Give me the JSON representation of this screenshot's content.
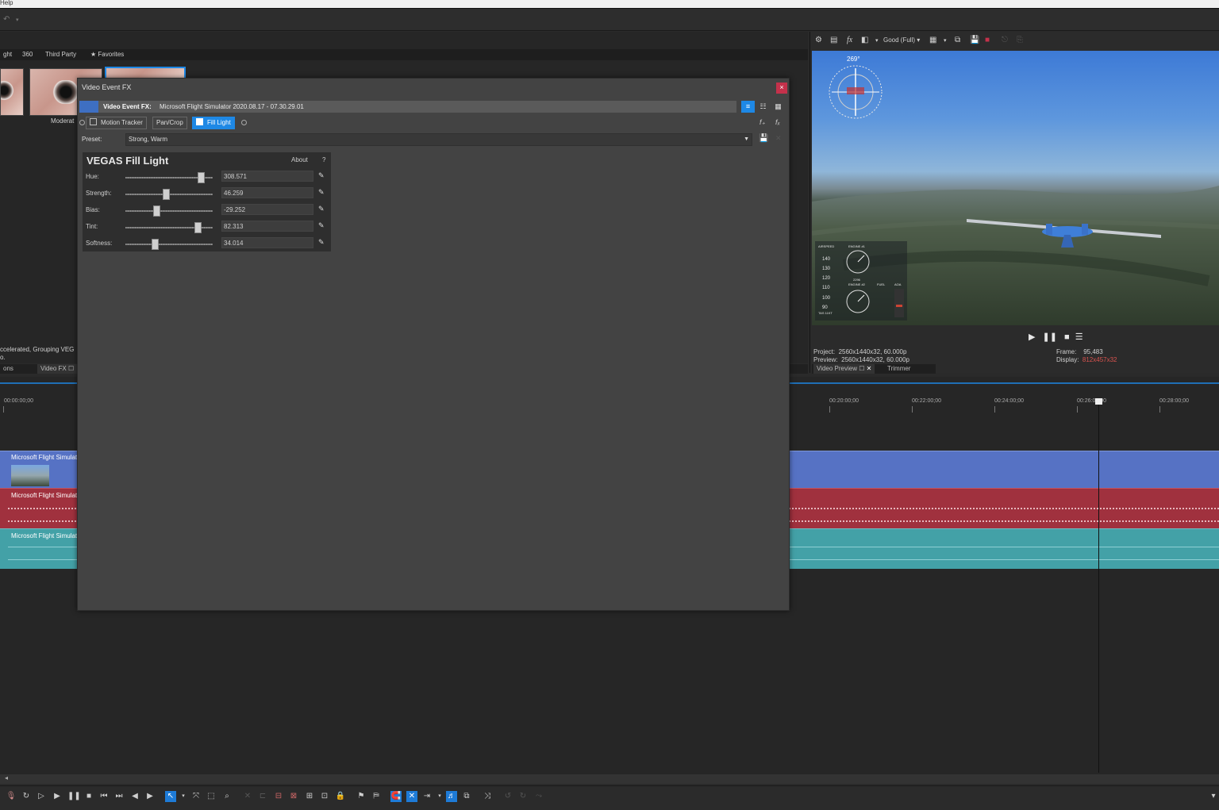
{
  "menubar": {
    "help": "Help"
  },
  "fx_browser": {
    "tabs": [
      "ght",
      "360",
      "Third Party",
      "Favorites"
    ],
    "thumb_caption": "Moderat"
  },
  "status": {
    "line1": "ccelerated, Grouping VEG",
    "line2": "o."
  },
  "left_bottom_tabs": {
    "tab1": "ons",
    "tab2": "Video FX"
  },
  "dialog": {
    "title": "Video Event FX",
    "close": "×",
    "header_label": "Video Event FX:",
    "header_name": "Microsoft Flight Simulator 2020.08.17 - 07.30.29.01",
    "chain": [
      {
        "label": "Motion Tracker",
        "checked": false
      },
      {
        "label": "Pan/Crop",
        "checked": false
      },
      {
        "label": "Fill Light",
        "checked": true
      }
    ],
    "preset_label": "Preset:",
    "preset_value": "Strong, Warm",
    "plugin": {
      "title": "VEGAS Fill Light",
      "about": "About",
      "help": "?",
      "params": [
        {
          "label": "Hue:",
          "value": "308.571",
          "level": 0.86
        },
        {
          "label": "Strength:",
          "value": "46.259",
          "level": 0.46
        },
        {
          "label": "Bias:",
          "value": "-29.252",
          "level": 0.35
        },
        {
          "label": "Tint:",
          "value": "82.313",
          "level": 0.83
        },
        {
          "label": "Softness:",
          "value": "34.014",
          "level": 0.34
        }
      ]
    }
  },
  "preview": {
    "quality": "Good (Full)",
    "project_label": "Project:",
    "project_value": "2560x1440x32, 60.000p",
    "preview_label": "Preview:",
    "preview_value": "2560x1440x32, 60.000p",
    "frame_label": "Frame:",
    "frame_value": "95,483",
    "display_label": "Display:",
    "display_value": "812x457x32",
    "tab1": "Video Preview",
    "tab2": "Trimmer",
    "hud_heading": "269°",
    "hud_airspeed": "AIRSPEED",
    "hud_engine1": "ENGINE #1",
    "hud_engine2": "ENGINE #2",
    "hud_fuel": "FUEL",
    "hud_aoa": "AOA",
    "hud_tas": "TAS 11KT",
    "hud_speeds": [
      "140",
      "130",
      "120",
      "110",
      "100",
      "90"
    ],
    "hud_rpm": "2296"
  },
  "timeline": {
    "ticks": [
      "00:00:00;00",
      "00:20:00;00",
      "00:22:00;00",
      "00:24:00;00",
      "00:26:00;00",
      "00:28:00;00"
    ],
    "clips": [
      {
        "title": "Microsoft Flight Simulat",
        "color": "#5672c4"
      },
      {
        "title": "Microsoft Flight Simulat",
        "color": "#a0313e"
      },
      {
        "title": "Microsoft Flight Simulat",
        "color": "#43a1a7"
      }
    ]
  },
  "colors": {
    "accent": "#1e88e5",
    "close": "#c4314b",
    "video_track": "#5672c4",
    "audio_track": "#a0313e",
    "third_track": "#43a1a7"
  }
}
